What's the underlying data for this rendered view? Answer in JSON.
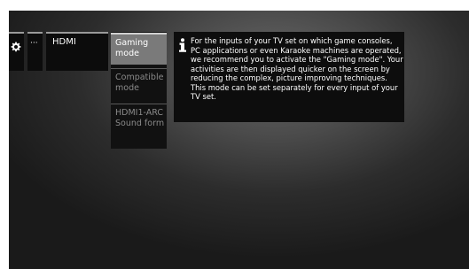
{
  "menu": {
    "settings_icon": "gear-icon",
    "more_label": "···",
    "source_label": "HDMI"
  },
  "submenu": {
    "items": [
      {
        "label_line1": "Gaming",
        "label_line2": "mode",
        "selected": true
      },
      {
        "label_line1": "Compatible",
        "label_line2": "mode",
        "selected": false
      },
      {
        "label_line1": "HDMI1-ARC",
        "label_line2": "Sound form",
        "selected": false
      }
    ]
  },
  "info": {
    "icon": "info-icon",
    "text": "For the inputs of your TV set on which game consoles, PC applications or even Karaoke machines are operated, we recommend you to activate the \"Gaming mode\". Your activities are then displayed quicker on the screen by reducing the complex, picture improving techniques. This mode can be set separately for every input of your TV set."
  }
}
